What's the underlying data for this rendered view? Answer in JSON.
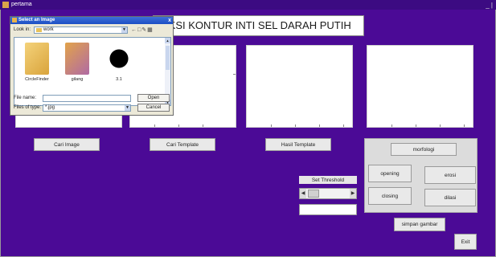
{
  "window": {
    "title": "pertama",
    "controls": "_ |"
  },
  "banner": {
    "text": "EKSI KONTUR INTI SEL DARAH PUTIH"
  },
  "buttons": {
    "cari_image": "Cari Image",
    "cari_template": "Cari Template",
    "hasil_template": "Hasil Template",
    "morfologi": "morfologi",
    "opening": "opening",
    "erosi": "erosi",
    "closing": "closing",
    "dilasi": "dilasi",
    "simpan_gambar": "simpan gambar",
    "exit": "Exit"
  },
  "threshold": {
    "label": "Set Threshold",
    "value": ""
  },
  "dialog": {
    "title": "Select an Image",
    "look_in_label": "Look in:",
    "look_in_value": "work",
    "files": [
      {
        "name": "CircleFinder",
        "kind": "folder"
      },
      {
        "name": "gilang",
        "kind": "folder"
      },
      {
        "name": "3.1",
        "kind": "image"
      }
    ],
    "file_name_label": "File name:",
    "file_name_value": "",
    "files_of_type_label": "Files of type:",
    "files_of_type_value": "*.jpg",
    "open_label": "Open",
    "cancel_label": "Cancel",
    "close_glyph": "x"
  },
  "colors": {
    "background": "#4b0a96",
    "dialog_title": "#1c4fc4"
  }
}
